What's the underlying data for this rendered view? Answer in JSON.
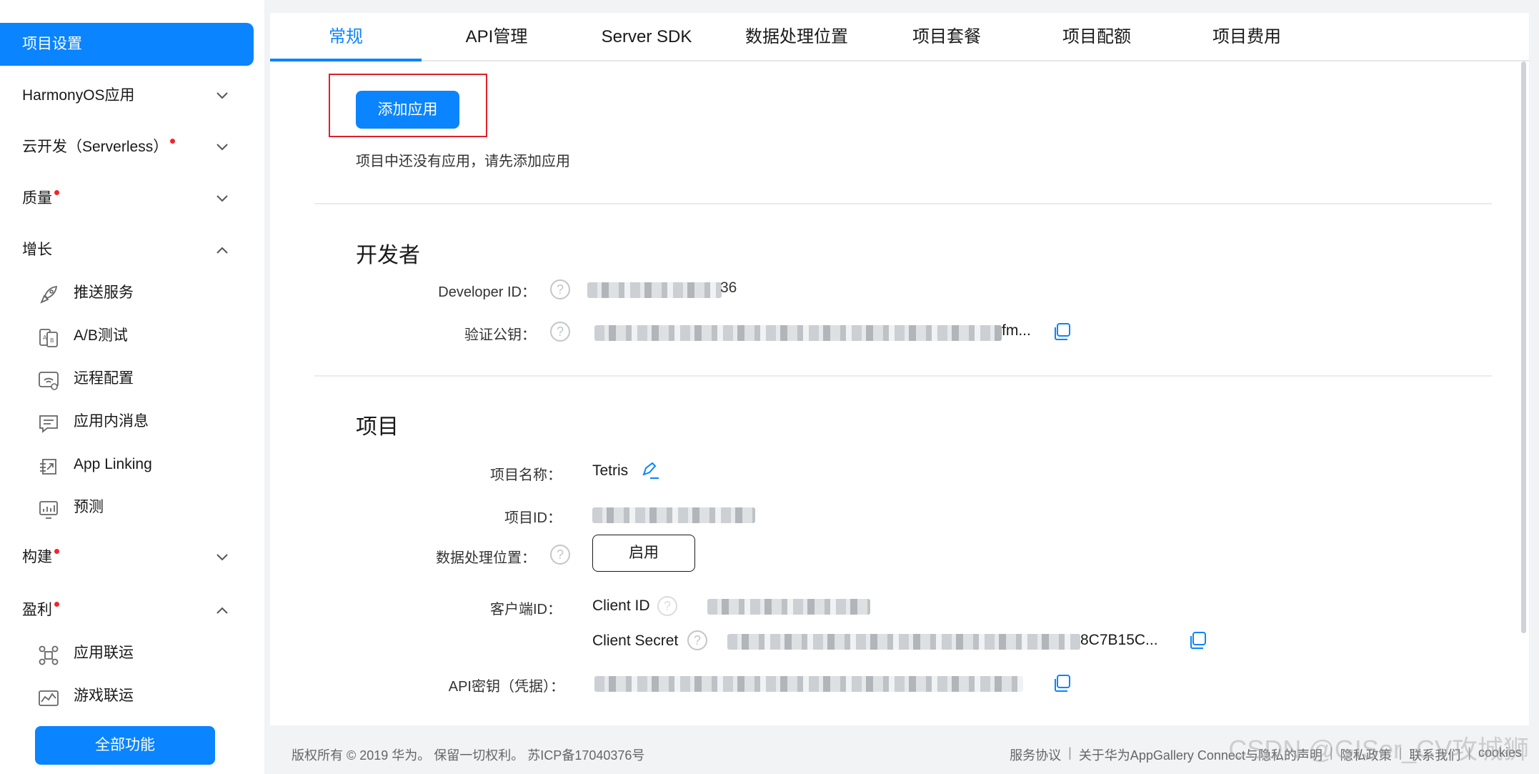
{
  "sidebar": {
    "active_item": "项目设置",
    "groups": [
      {
        "label": "HarmonyOS应用",
        "dot": false,
        "expanded": false
      },
      {
        "label": "云开发（Serverless）",
        "dot": true,
        "expanded": false
      },
      {
        "label": "质量",
        "dot": true,
        "expanded": false
      },
      {
        "label": "增长",
        "dot": false,
        "expanded": true
      },
      {
        "label": "构建",
        "dot": true,
        "expanded": false
      },
      {
        "label": "盈利",
        "dot": true,
        "expanded": true
      }
    ],
    "growth_items": [
      {
        "label": "推送服务",
        "icon": "rocket-icon"
      },
      {
        "label": "A/B测试",
        "icon": "ab-test-icon"
      },
      {
        "label": "远程配置",
        "icon": "remote-config-icon"
      },
      {
        "label": "应用内消息",
        "icon": "message-icon"
      },
      {
        "label": "App Linking",
        "icon": "app-linking-icon"
      },
      {
        "label": "预测",
        "icon": "prediction-icon"
      }
    ],
    "monetize_items": [
      {
        "label": "应用联运",
        "icon": "app-coop-icon"
      },
      {
        "label": "游戏联运",
        "icon": "game-coop-icon"
      }
    ],
    "all_features_label": "全部功能"
  },
  "tabs": [
    "常规",
    "API管理",
    "Server SDK",
    "数据处理位置",
    "项目套餐",
    "项目配额",
    "项目费用"
  ],
  "main": {
    "add_app_label": "添加应用",
    "empty_note": "项目中还没有应用，请先添加应用",
    "developer": {
      "title": "开发者",
      "developer_id_label": "Developer ID：",
      "developer_id_visible_suffix": "36",
      "public_key_label": "验证公钥：",
      "public_key_visible_suffix": "fm..."
    },
    "project": {
      "title": "项目",
      "name_label": "项目名称：",
      "name_value": "Tetris",
      "id_label": "项目ID：",
      "location_label": "数据处理位置：",
      "enable_label": "启用",
      "client_label": "客户端ID：",
      "client_id_label": "Client ID",
      "client_secret_label": "Client Secret",
      "client_secret_visible_suffix": "8C7B15C...",
      "api_key_label": "API密钥（凭据）："
    }
  },
  "footer": {
    "copyright": "版权所有 © 2019 华为。 保留一切权利。 苏ICP备17040376号",
    "links": [
      "服务协议",
      "关于华为AppGallery Connect与隐私的声明",
      "隐私政策",
      "联系我们",
      "cookies"
    ]
  },
  "watermark": "CSDN @GISer_CV攻城狮",
  "colors": {
    "accent": "#0a84ff",
    "highlight_border": "#e0202a",
    "badge_dot": "#f5222d"
  }
}
